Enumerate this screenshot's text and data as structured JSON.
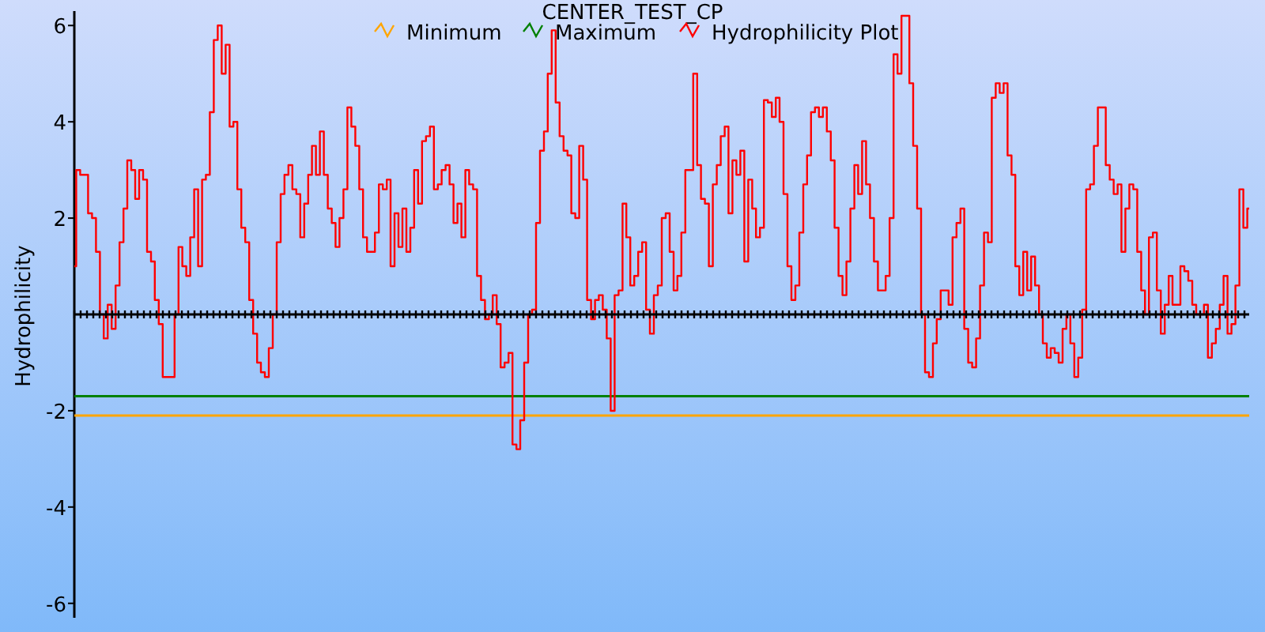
{
  "chart_data": {
    "type": "line",
    "title": "CENTER_TEST_CP",
    "legend": "top",
    "ylabel": "Hydrophilicity",
    "ylim": [
      -6.3,
      6.3
    ],
    "yticks": [
      -6,
      -4,
      -2,
      2,
      4,
      6
    ],
    "series": [
      {
        "name": "Minimum",
        "color": "#ffa500",
        "values": [
          -2.1,
          -2.1,
          -2.1,
          -2.1,
          -2.1,
          -2.1,
          -2.1,
          -2.1,
          -2.1,
          -2.1,
          -2.1,
          -2.1,
          -2.1,
          -2.1,
          -2.1,
          -2.1,
          -2.1,
          -2.1,
          -2.1,
          -2.1,
          -2.1,
          -2.1,
          -2.1,
          -2.1,
          -2.1,
          -2.1,
          -2.1,
          -2.1,
          -2.1,
          -2.1,
          -2.1,
          -2.1,
          -2.1,
          -2.1,
          -2.1,
          -2.1,
          -2.1,
          -2.1,
          -2.1,
          -2.1,
          -2.1,
          -2.1,
          -2.1,
          -2.1,
          -2.1,
          -2.1,
          -2.1,
          -2.1,
          -2.1,
          -2.1,
          -2.1,
          -2.1,
          -2.1,
          -2.1,
          -2.1,
          -2.1,
          -2.1,
          -2.1,
          -2.1,
          -2.1,
          -2.1,
          -2.1,
          -2.1,
          -2.1,
          -2.1,
          -2.1,
          -2.1,
          -2.1,
          -2.1,
          -2.1,
          -2.1,
          -2.1,
          -2.1,
          -2.1,
          -2.1,
          -2.1,
          -2.1,
          -2.1,
          -2.1,
          -2.1,
          -2.1,
          -2.1,
          -2.1,
          -2.1,
          -2.1,
          -2.1,
          -2.1,
          -2.1,
          -2.1,
          -2.1,
          -2.1,
          -2.1,
          -2.1,
          -2.1,
          -2.1,
          -2.1,
          -2.1,
          -2.1,
          -2.1,
          -2.1,
          -2.1,
          -2.1,
          -2.1,
          -2.1,
          -2.1,
          -2.1,
          -2.1,
          -2.1,
          -2.1,
          -2.1,
          -2.1,
          -2.1,
          -2.1,
          -2.1,
          -2.1,
          -2.1,
          -2.1,
          -2.1,
          -2.1,
          -2.1,
          -2.1,
          -2.1,
          -2.1,
          -2.1,
          -2.1,
          -2.1,
          -2.1,
          -2.1,
          -2.1,
          -2.1,
          -2.1,
          -2.1,
          -2.1,
          -2.1,
          -2.1,
          -2.1,
          -2.1,
          -2.1,
          -2.1,
          -2.1,
          -2.1,
          -2.1,
          -2.1,
          -2.1,
          -2.1,
          -2.1,
          -2.1,
          -2.1,
          -2.1,
          -2.1,
          -2.1,
          -2.1,
          -2.1,
          -2.1,
          -2.1,
          -2.1,
          -2.1,
          -2.1,
          -2.1,
          -2.1,
          -2.1,
          -2.1,
          -2.1,
          -2.1,
          -2.1,
          -2.1,
          -2.1,
          -2.1,
          -2.1,
          -2.1,
          -2.1,
          -2.1,
          -2.1,
          -2.1,
          -2.1,
          -2.1,
          -2.1,
          -2.1,
          -2.1,
          -2.1,
          -2.1,
          -2.1,
          -2.1,
          -2.1,
          -2.1,
          -2.1,
          -2.1,
          -2.1,
          -2.1,
          -2.1,
          -2.1,
          -2.1,
          -2.1,
          -2.1,
          -2.1,
          -2.1,
          -2.1,
          -2.1,
          -2.1,
          -2.1,
          -2.1,
          -2.1,
          -2.1,
          -2.1,
          -2.1,
          -2.1,
          -2.1,
          -2.1,
          -2.1,
          -2.1,
          -2.1,
          -2.1,
          -2.1,
          -2.1,
          -2.1,
          -2.1,
          -2.1,
          -2.1,
          -2.1,
          -2.1,
          -2.1,
          -2.1,
          -2.1,
          -2.1,
          -2.1,
          -2.1,
          -2.1,
          -2.1,
          -2.1,
          -2.1,
          -2.1,
          -2.1,
          -2.1,
          -2.1,
          -2.1,
          -2.1,
          -2.1,
          -2.1,
          -2.1,
          -2.1,
          -2.1,
          -2.1,
          -2.1,
          -2.1,
          -2.1,
          -2.1,
          -2.1,
          -2.1,
          -2.1,
          -2.1,
          -2.1,
          -2.1,
          -2.1,
          -2.1,
          -2.1,
          -2.1,
          -2.1,
          -2.1,
          -2.1,
          -2.1,
          -2.1,
          -2.1,
          -2.1,
          -2.1,
          -2.1,
          -2.1,
          -2.1,
          -2.1,
          -2.1,
          -2.1,
          -2.1,
          -2.1,
          -2.1,
          -2.1,
          -2.1,
          -2.1,
          -2.1,
          -2.1,
          -2.1,
          -2.1,
          -2.1,
          -2.1,
          -2.1,
          -2.1,
          -2.1,
          -2.1,
          -2.1,
          -2.1,
          -2.1,
          -2.1,
          -2.1,
          -2.1,
          -2.1,
          -2.1,
          -2.1,
          -2.1,
          -2.1,
          -2.1,
          -2.1,
          -2.1
        ]
      },
      {
        "name": "Maximum",
        "color": "#008000",
        "values": [
          -1.7,
          -1.7,
          -1.7,
          -1.7,
          -1.7,
          -1.7,
          -1.7,
          -1.7,
          -1.7,
          -1.7,
          -1.7,
          -1.7,
          -1.7,
          -1.7,
          -1.7,
          -1.7,
          -1.7,
          -1.7,
          -1.7,
          -1.7,
          -1.7,
          -1.7,
          -1.7,
          -1.7,
          -1.7,
          -1.7,
          -1.7,
          -1.7,
          -1.7,
          -1.7,
          -1.7,
          -1.7,
          -1.7,
          -1.7,
          -1.7,
          -1.7,
          -1.7,
          -1.7,
          -1.7,
          -1.7,
          -1.7,
          -1.7,
          -1.7,
          -1.7,
          -1.7,
          -1.7,
          -1.7,
          -1.7,
          -1.7,
          -1.7,
          -1.7,
          -1.7,
          -1.7,
          -1.7,
          -1.7,
          -1.7,
          -1.7,
          -1.7,
          -1.7,
          -1.7,
          -1.7,
          -1.7,
          -1.7,
          -1.7,
          -1.7,
          -1.7,
          -1.7,
          -1.7,
          -1.7,
          -1.7,
          -1.7,
          -1.7,
          -1.7,
          -1.7,
          -1.7,
          -1.7,
          -1.7,
          -1.7,
          -1.7,
          -1.7,
          -1.7,
          -1.7,
          -1.7,
          -1.7,
          -1.7,
          -1.7,
          -1.7,
          -1.7,
          -1.7,
          -1.7,
          -1.7,
          -1.7,
          -1.7,
          -1.7,
          -1.7,
          -1.7,
          -1.7,
          -1.7,
          -1.7,
          -1.7,
          -1.7,
          -1.7,
          -1.7,
          -1.7,
          -1.7,
          -1.7,
          -1.7,
          -1.7,
          -1.7,
          -1.7,
          -1.7,
          -1.7,
          -1.7,
          -1.7,
          -1.7,
          -1.7,
          -1.7,
          -1.7,
          -1.7,
          -1.7,
          -1.7,
          -1.7,
          -1.7,
          -1.7,
          -1.7,
          -1.7,
          -1.7,
          -1.7,
          -1.7,
          -1.7,
          -1.7,
          -1.7,
          -1.7,
          -1.7,
          -1.7,
          -1.7,
          -1.7,
          -1.7,
          -1.7,
          -1.7,
          -1.7,
          -1.7,
          -1.7,
          -1.7,
          -1.7,
          -1.7,
          -1.7,
          -1.7,
          -1.7,
          -1.7,
          -1.7,
          -1.7,
          -1.7,
          -1.7,
          -1.7,
          -1.7,
          -1.7,
          -1.7,
          -1.7,
          -1.7,
          -1.7,
          -1.7,
          -1.7,
          -1.7,
          -1.7,
          -1.7,
          -1.7,
          -1.7,
          -1.7,
          -1.7,
          -1.7,
          -1.7,
          -1.7,
          -1.7,
          -1.7,
          -1.7,
          -1.7,
          -1.7,
          -1.7,
          -1.7,
          -1.7,
          -1.7,
          -1.7,
          -1.7,
          -1.7,
          -1.7,
          -1.7,
          -1.7,
          -1.7,
          -1.7,
          -1.7,
          -1.7,
          -1.7,
          -1.7,
          -1.7,
          -1.7,
          -1.7,
          -1.7,
          -1.7,
          -1.7,
          -1.7,
          -1.7,
          -1.7,
          -1.7,
          -1.7,
          -1.7,
          -1.7,
          -1.7,
          -1.7,
          -1.7,
          -1.7,
          -1.7,
          -1.7,
          -1.7,
          -1.7,
          -1.7,
          -1.7,
          -1.7,
          -1.7,
          -1.7,
          -1.7,
          -1.7,
          -1.7,
          -1.7,
          -1.7,
          -1.7,
          -1.7,
          -1.7,
          -1.7,
          -1.7,
          -1.7,
          -1.7,
          -1.7,
          -1.7,
          -1.7,
          -1.7,
          -1.7,
          -1.7,
          -1.7,
          -1.7,
          -1.7,
          -1.7,
          -1.7,
          -1.7,
          -1.7,
          -1.7,
          -1.7,
          -1.7,
          -1.7,
          -1.7,
          -1.7,
          -1.7,
          -1.7,
          -1.7,
          -1.7,
          -1.7,
          -1.7,
          -1.7,
          -1.7,
          -1.7,
          -1.7,
          -1.7,
          -1.7,
          -1.7,
          -1.7,
          -1.7,
          -1.7,
          -1.7,
          -1.7,
          -1.7,
          -1.7,
          -1.7,
          -1.7,
          -1.7,
          -1.7,
          -1.7,
          -1.7,
          -1.7,
          -1.7,
          -1.7,
          -1.7,
          -1.7,
          -1.7,
          -1.7,
          -1.7,
          -1.7,
          -1.7,
          -1.7,
          -1.7,
          -1.7,
          -1.7,
          -1.7,
          -1.7,
          -1.7,
          -1.7,
          -1.7,
          -1.7,
          -1.7,
          -1.7,
          -1.7
        ]
      },
      {
        "name": "Hydrophilicity Plot",
        "color": "#ff0000",
        "values": [
          1.0,
          3.0,
          2.9,
          2.9,
          2.1,
          2.0,
          1.3,
          0,
          -0.5,
          0.2,
          -0.3,
          0.6,
          1.5,
          2.2,
          3.2,
          3.0,
          2.4,
          3.0,
          2.8,
          1.3,
          1.1,
          0.3,
          -0.2,
          -1.3,
          -1.3,
          -1.3,
          0,
          1.4,
          1.0,
          0.8,
          1.6,
          2.6,
          1.0,
          2.8,
          2.9,
          4.2,
          5.7,
          6.0,
          5.0,
          5.6,
          3.9,
          4.0,
          2.6,
          1.8,
          1.5,
          0.3,
          -0.4,
          -1.0,
          -1.2,
          -1.3,
          -0.7,
          0,
          1.5,
          2.5,
          2.9,
          3.1,
          2.6,
          2.5,
          1.6,
          2.3,
          2.9,
          3.5,
          2.9,
          3.8,
          2.9,
          2.2,
          1.9,
          1.4,
          2.0,
          2.6,
          4.3,
          3.9,
          3.5,
          2.6,
          1.6,
          1.3,
          1.3,
          1.7,
          2.7,
          2.6,
          2.8,
          1.0,
          2.1,
          1.4,
          2.2,
          1.3,
          1.8,
          3.0,
          2.3,
          3.6,
          3.7,
          3.9,
          2.6,
          2.7,
          3.0,
          3.1,
          2.7,
          1.9,
          2.3,
          1.6,
          3.0,
          2.7,
          2.6,
          0.8,
          0.3,
          -0.1,
          0,
          0.4,
          -0.2,
          -1.1,
          -1.0,
          -0.8,
          -2.7,
          -2.8,
          -2.2,
          -1.0,
          0,
          0.1,
          1.9,
          3.4,
          3.8,
          5.0,
          5.9,
          4.4,
          3.7,
          3.4,
          3.3,
          2.1,
          2.0,
          3.5,
          2.8,
          0.3,
          -0.1,
          0.3,
          0.4,
          0.1,
          -0.5,
          -2.0,
          0.4,
          0.5,
          2.3,
          1.6,
          0.6,
          0.8,
          1.3,
          1.5,
          0.1,
          -0.4,
          0.4,
          0.6,
          2.0,
          2.1,
          1.3,
          0.5,
          0.8,
          1.7,
          3.0,
          3.0,
          5.0,
          3.1,
          2.4,
          2.3,
          1.0,
          2.7,
          3.1,
          3.7,
          3.9,
          2.1,
          3.2,
          2.9,
          3.4,
          1.1,
          2.8,
          2.2,
          1.6,
          1.8,
          4.45,
          4.4,
          4.1,
          4.5,
          4.0,
          2.5,
          1.0,
          0.3,
          0.6,
          1.7,
          2.7,
          3.3,
          4.2,
          4.3,
          4.1,
          4.3,
          3.8,
          3.2,
          1.8,
          0.8,
          0.4,
          1.1,
          2.2,
          3.1,
          2.5,
          3.6,
          2.7,
          2.0,
          1.1,
          0.5,
          0.5,
          0.8,
          2.0,
          5.4,
          5.0,
          6.2,
          6.2,
          4.8,
          3.5,
          2.2,
          0,
          -1.2,
          -1.3,
          -0.6,
          -0.1,
          0.5,
          0.5,
          0.2,
          1.6,
          1.9,
          2.2,
          -0.3,
          -1.0,
          -1.1,
          -0.5,
          0.6,
          1.7,
          1.5,
          4.5,
          4.8,
          4.6,
          4.8,
          3.3,
          2.9,
          1.0,
          0.4,
          1.3,
          0.5,
          1.2,
          0.6,
          0,
          -0.6,
          -0.9,
          -0.7,
          -0.8,
          -1.0,
          -0.3,
          0,
          -0.6,
          -1.3,
          -0.9,
          0.1,
          2.6,
          2.7,
          3.5,
          4.3,
          4.3,
          3.1,
          2.8,
          2.5,
          2.7,
          1.3,
          2.2,
          2.7,
          2.6,
          1.3,
          0.5,
          0,
          1.6,
          1.7,
          0.5,
          -0.4,
          0.2,
          0.8,
          0.2,
          0.2,
          1.0,
          0.9,
          0.7,
          0.2,
          0,
          0,
          0.2,
          -0.9,
          -0.6,
          -0.3,
          0.2,
          0.8,
          -0.4,
          -0.2,
          0.6,
          2.6,
          1.8,
          2.2
        ]
      }
    ]
  }
}
